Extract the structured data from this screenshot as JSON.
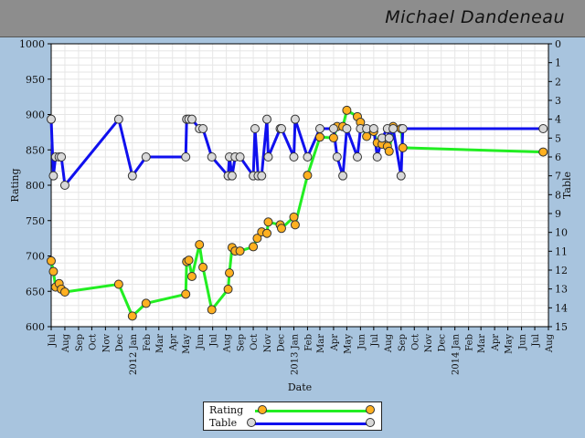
{
  "header": {
    "name": "Michael Dandeneau"
  },
  "chart_data": {
    "type": "line",
    "xlabel": "Date",
    "ylabel": "Rating",
    "y2label": "Table",
    "ylim": [
      600,
      1000
    ],
    "y2lim": [
      0,
      15
    ],
    "y2_inverted": true,
    "yticks": [
      600,
      650,
      700,
      750,
      800,
      850,
      900,
      950,
      1000
    ],
    "y2ticks": [
      0,
      1,
      2,
      3,
      4,
      5,
      6,
      7,
      8,
      9,
      10,
      11,
      12,
      13,
      14,
      15
    ],
    "xlim": [
      "2011-07-01",
      "2014-08-01"
    ],
    "xticks": [
      {
        "date": "2011-07-01",
        "label": "Jul"
      },
      {
        "date": "2011-08-01",
        "label": "Aug"
      },
      {
        "date": "2011-09-01",
        "label": "Sep"
      },
      {
        "date": "2011-10-01",
        "label": "Oct"
      },
      {
        "date": "2011-11-01",
        "label": "Nov"
      },
      {
        "date": "2011-12-01",
        "label": "Dec"
      },
      {
        "date": "2012-01-01",
        "label": "2012 Jan"
      },
      {
        "date": "2012-02-01",
        "label": "Feb"
      },
      {
        "date": "2012-03-01",
        "label": "Mar"
      },
      {
        "date": "2012-04-01",
        "label": "Apr"
      },
      {
        "date": "2012-05-01",
        "label": "May"
      },
      {
        "date": "2012-06-01",
        "label": "Jun"
      },
      {
        "date": "2012-07-01",
        "label": "Jul"
      },
      {
        "date": "2012-08-01",
        "label": "Aug"
      },
      {
        "date": "2012-09-01",
        "label": "Sep"
      },
      {
        "date": "2012-10-01",
        "label": "Oct"
      },
      {
        "date": "2012-11-01",
        "label": "Nov"
      },
      {
        "date": "2012-12-01",
        "label": "Dec"
      },
      {
        "date": "2013-01-01",
        "label": "2013 Jan"
      },
      {
        "date": "2013-02-01",
        "label": "Feb"
      },
      {
        "date": "2013-03-01",
        "label": "Mar"
      },
      {
        "date": "2013-04-01",
        "label": "Apr"
      },
      {
        "date": "2013-05-01",
        "label": "May"
      },
      {
        "date": "2013-06-01",
        "label": "Jun"
      },
      {
        "date": "2013-07-01",
        "label": "Jul"
      },
      {
        "date": "2013-08-01",
        "label": "Aug"
      },
      {
        "date": "2013-09-01",
        "label": "Sep"
      },
      {
        "date": "2013-10-01",
        "label": "Oct"
      },
      {
        "date": "2013-11-01",
        "label": "Nov"
      },
      {
        "date": "2013-12-01",
        "label": "Dec"
      },
      {
        "date": "2014-01-01",
        "label": "2014 Jan"
      },
      {
        "date": "2014-02-01",
        "label": "Feb"
      },
      {
        "date": "2014-03-01",
        "label": "Mar"
      },
      {
        "date": "2014-04-01",
        "label": "Apr"
      },
      {
        "date": "2014-05-01",
        "label": "May"
      },
      {
        "date": "2014-06-01",
        "label": "Jun"
      },
      {
        "date": "2014-07-01",
        "label": "Jul"
      },
      {
        "date": "2014-08-01",
        "label": "Aug"
      }
    ],
    "grid": true,
    "legend_position": "bottom-center",
    "series": [
      {
        "name": "Rating",
        "axis": "left",
        "color": "#22ee22",
        "marker_color": "#ffb020",
        "points": [
          [
            "2011-07-01",
            693
          ],
          [
            "2011-07-06",
            678
          ],
          [
            "2011-07-11",
            656
          ],
          [
            "2011-07-19",
            661
          ],
          [
            "2011-07-24",
            653
          ],
          [
            "2011-08-01",
            649
          ],
          [
            "2011-12-01",
            660
          ],
          [
            "2012-01-01",
            615
          ],
          [
            "2012-02-01",
            633
          ],
          [
            "2012-05-01",
            646
          ],
          [
            "2012-05-03",
            692
          ],
          [
            "2012-05-08",
            694
          ],
          [
            "2012-05-15",
            671
          ],
          [
            "2012-06-01",
            716
          ],
          [
            "2012-06-09",
            684
          ],
          [
            "2012-06-29",
            624
          ],
          [
            "2012-08-05",
            653
          ],
          [
            "2012-08-08",
            676
          ],
          [
            "2012-08-14",
            712
          ],
          [
            "2012-08-21",
            707
          ],
          [
            "2012-09-01",
            707
          ],
          [
            "2012-10-01",
            713
          ],
          [
            "2012-10-10",
            725
          ],
          [
            "2012-10-20",
            734
          ],
          [
            "2012-11-01",
            732
          ],
          [
            "2012-11-04",
            748
          ],
          [
            "2012-12-01",
            744
          ],
          [
            "2012-12-04",
            739
          ],
          [
            "2013-01-01",
            755
          ],
          [
            "2013-01-04",
            744
          ],
          [
            "2013-02-01",
            814
          ],
          [
            "2013-03-01",
            868
          ],
          [
            "2013-04-01",
            867
          ],
          [
            "2013-04-09",
            883
          ],
          [
            "2013-04-22",
            883
          ],
          [
            "2013-05-01",
            906
          ],
          [
            "2013-05-25",
            897
          ],
          [
            "2013-06-01",
            889
          ],
          [
            "2013-06-15",
            869
          ],
          [
            "2013-07-01",
            876
          ],
          [
            "2013-07-09",
            860
          ],
          [
            "2013-07-20",
            858
          ],
          [
            "2013-08-01",
            855
          ],
          [
            "2013-08-05",
            848
          ],
          [
            "2013-08-14",
            883
          ],
          [
            "2013-09-01",
            880
          ],
          [
            "2013-09-05",
            853
          ],
          [
            "2014-07-20",
            847
          ]
        ]
      },
      {
        "name": "Table",
        "axis": "right",
        "color": "#1010ee",
        "marker_color": "#d8d8d8",
        "points": [
          [
            "2011-07-01",
            4
          ],
          [
            "2011-07-06",
            7
          ],
          [
            "2011-07-11",
            6
          ],
          [
            "2011-07-19",
            6
          ],
          [
            "2011-07-24",
            6
          ],
          [
            "2011-08-01",
            7.5
          ],
          [
            "2011-12-01",
            4
          ],
          [
            "2012-01-01",
            7
          ],
          [
            "2012-02-01",
            6
          ],
          [
            "2012-05-01",
            6
          ],
          [
            "2012-05-03",
            4
          ],
          [
            "2012-05-08",
            4
          ],
          [
            "2012-05-15",
            4
          ],
          [
            "2012-06-01",
            4.5
          ],
          [
            "2012-06-09",
            4.5
          ],
          [
            "2012-06-29",
            6
          ],
          [
            "2012-08-05",
            7
          ],
          [
            "2012-08-08",
            6
          ],
          [
            "2012-08-14",
            7
          ],
          [
            "2012-08-21",
            6
          ],
          [
            "2012-09-01",
            6
          ],
          [
            "2012-10-01",
            7
          ],
          [
            "2012-10-05",
            4.5
          ],
          [
            "2012-10-12",
            7
          ],
          [
            "2012-10-20",
            7
          ],
          [
            "2012-11-01",
            4
          ],
          [
            "2012-11-04",
            6
          ],
          [
            "2012-12-01",
            4.5
          ],
          [
            "2012-12-04",
            4.5
          ],
          [
            "2013-01-01",
            6
          ],
          [
            "2013-01-04",
            4
          ],
          [
            "2013-02-01",
            6
          ],
          [
            "2013-03-01",
            4.5
          ],
          [
            "2013-04-01",
            4.5
          ],
          [
            "2013-04-09",
            6
          ],
          [
            "2013-04-22",
            7
          ],
          [
            "2013-05-01",
            4.5
          ],
          [
            "2013-05-25",
            6
          ],
          [
            "2013-06-01",
            4.5
          ],
          [
            "2013-06-15",
            4.5
          ],
          [
            "2013-07-01",
            4.5
          ],
          [
            "2013-07-09",
            6
          ],
          [
            "2013-07-20",
            5
          ],
          [
            "2013-08-01",
            4.5
          ],
          [
            "2013-08-05",
            5
          ],
          [
            "2013-08-14",
            4.5
          ],
          [
            "2013-09-01",
            7
          ],
          [
            "2013-09-05",
            4.5
          ],
          [
            "2014-07-20",
            4.5
          ]
        ]
      }
    ]
  }
}
